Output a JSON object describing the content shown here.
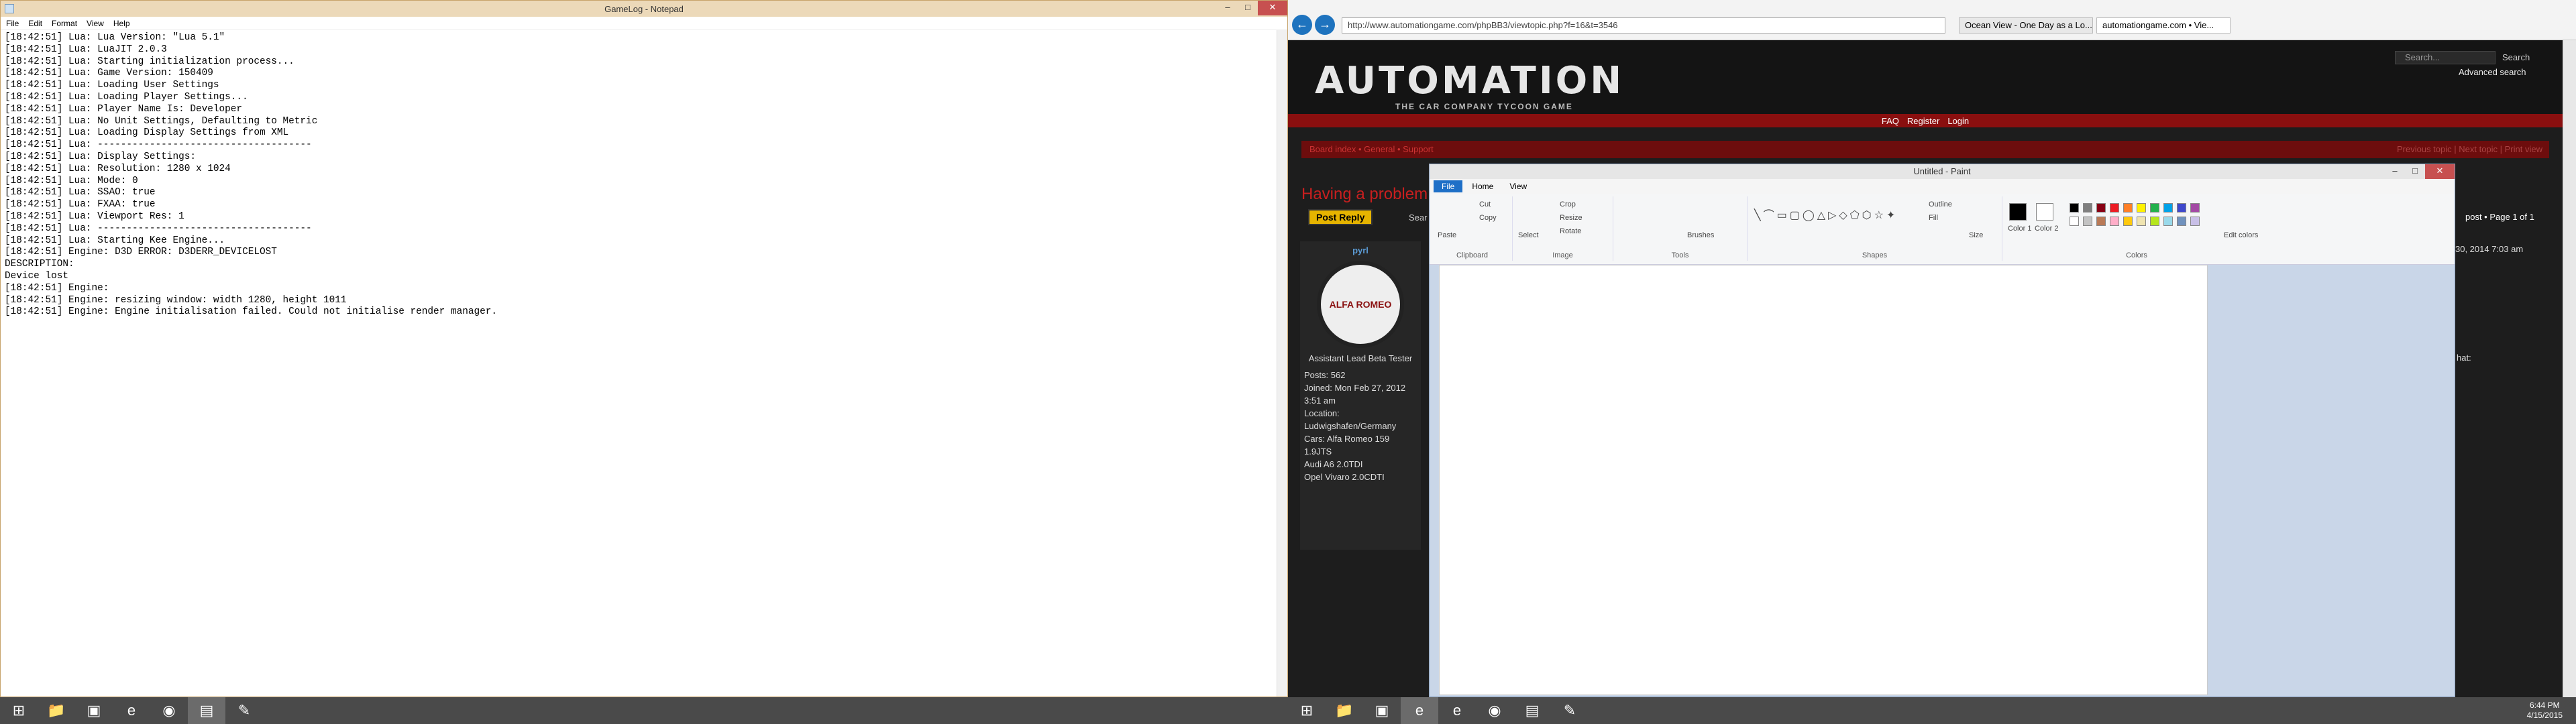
{
  "notepad": {
    "title": "GameLog - Notepad",
    "menu": [
      "File",
      "Edit",
      "Format",
      "View",
      "Help"
    ],
    "lines": [
      "[18:42:51] Lua: Lua Version: \"Lua 5.1\"",
      "[18:42:51] Lua: LuaJIT 2.0.3",
      "[18:42:51] Lua: Starting initialization process...",
      "[18:42:51] Lua: Game Version: 150409",
      "[18:42:51] Lua: Loading User Settings",
      "[18:42:51] Lua: Loading Player Settings...",
      "[18:42:51] Lua: Player Name Is: Developer",
      "[18:42:51] Lua: No Unit Settings, Defaulting to Metric",
      "[18:42:51] Lua: Loading Display Settings from XML",
      "[18:42:51] Lua: -------------------------------------",
      "[18:42:51] Lua: Display Settings:",
      "[18:42:51] Lua: Resolution: 1280 x 1024",
      "[18:42:51] Lua: Mode: 0",
      "[18:42:51] Lua: SSAO: true",
      "[18:42:51] Lua: FXAA: true",
      "[18:42:51] Lua: Viewport Res: 1",
      "[18:42:51] Lua: -------------------------------------",
      "[18:42:51] Lua: Starting Kee Engine...",
      "[18:42:51] Engine: D3D ERROR: D3DERR_DEVICELOST",
      "DESCRIPTION:",
      "Device lost",
      "[18:42:51] Engine:",
      "[18:42:51] Engine: resizing window: width 1280, height 1011",
      "[18:42:51] Engine: Engine initialisation failed. Could not initialise render manager."
    ]
  },
  "browser": {
    "url": "http://www.automationgame.com/phpBB3/viewtopic.php?f=16&t=3546",
    "tabs": [
      "Ocean View - One Day as a Lo...",
      "automationgame.com • Vie..."
    ],
    "site": {
      "logo": "AUTOMATION",
      "tagline": "THE CAR COMPANY TYCOON GAME",
      "search_placeholder": "Search...",
      "search_button": "Search",
      "advanced": "Advanced search",
      "nav": [
        "FAQ",
        "Register",
        "Login"
      ],
      "breadcrumbs": "Board index • General • Support",
      "crumbs_right": "Previous topic | Next topic | Print view",
      "topic_title": "Having a problem",
      "post_reply": "Post Reply",
      "search_partial": "Sear",
      "post_info": "post • Page 1 of 1",
      "post_date": "30, 2014 7:03 am",
      "partial_text": "hat:",
      "profile": {
        "name": "pyrl",
        "badge": "ALFA ROMEO",
        "rank": "Assistant Lead Beta Tester",
        "lines": [
          "Posts: 562",
          "Joined: Mon Feb 27, 2012",
          "3:51 am",
          "Location:",
          "Ludwigshafen/Germany",
          "Cars: Alfa Romeo 159",
          "1.9JTS",
          "Audi A6 2.0TDI",
          "Opel Vivaro 2.0CDTI"
        ]
      }
    }
  },
  "paint": {
    "title": "Untitled - Paint",
    "tabs": [
      "File",
      "Home",
      "View"
    ],
    "groups": [
      "Clipboard",
      "Image",
      "Tools",
      "Shapes",
      "Colors"
    ],
    "buttons": {
      "paste": "Paste",
      "cut": "Cut",
      "copy": "Copy",
      "select": "Select",
      "crop": "Crop",
      "resize": "Resize",
      "rotate": "Rotate",
      "brushes": "Brushes",
      "outline": "Outline",
      "fill": "Fill",
      "size": "Size",
      "color1": "Color 1",
      "color2": "Color 2",
      "edit_colors": "Edit colors"
    },
    "palette": [
      "#000000",
      "#7f7f7f",
      "#880015",
      "#ed1c24",
      "#ff7f27",
      "#fff200",
      "#22b14c",
      "#00a2e8",
      "#3f48cc",
      "#a349a4",
      "#ffffff",
      "#c3c3c3",
      "#b97a57",
      "#ffaec9",
      "#ffc90e",
      "#efe4b0",
      "#b5e61d",
      "#99d9ea",
      "#7092be",
      "#c8bfe7"
    ]
  },
  "taskbar": {
    "time": "6:44 PM",
    "date": "4/15/2015"
  }
}
